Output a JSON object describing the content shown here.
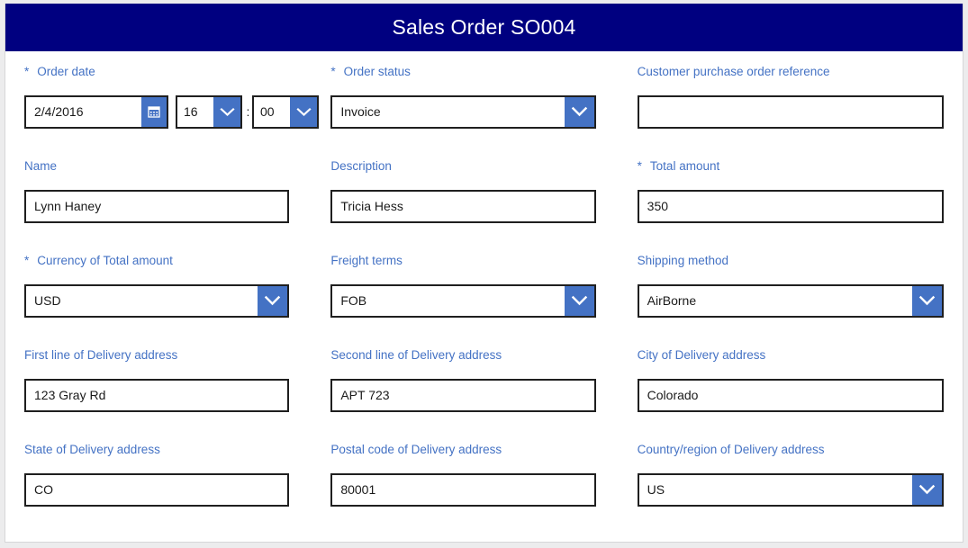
{
  "header": {
    "title": "Sales Order SO004",
    "background_color": "#000080",
    "text_color": "#ffffff"
  },
  "theme": {
    "label_color": "#4472c4",
    "accent_color": "#4472c4",
    "input_border_color": "#1f1f1f",
    "page_background": "#ececed",
    "card_background": "#ffffff"
  },
  "form": {
    "required_marker": "*",
    "time_separator": ":",
    "rows": [
      {
        "fields": [
          {
            "name": "order-date",
            "label": "Order date",
            "required": true,
            "type": "datetime",
            "date_value": "2/4/2016",
            "hour_value": "16",
            "minute_value": "00",
            "calendar_icon": "calendar-icon",
            "dropdown_icon": "chevron-down-icon"
          },
          {
            "name": "order-status",
            "label": "Order status",
            "required": true,
            "type": "combobox",
            "value": "Invoice",
            "dropdown_icon": "chevron-down-icon"
          },
          {
            "name": "customer-purchase-order-reference",
            "label": "Customer purchase order reference",
            "required": false,
            "type": "text",
            "value": "",
            "placeholder": ""
          }
        ]
      },
      {
        "fields": [
          {
            "name": "name",
            "label": "Name",
            "required": false,
            "type": "text",
            "value": "Lynn Haney",
            "placeholder": ""
          },
          {
            "name": "description",
            "label": "Description",
            "required": false,
            "type": "text",
            "value": "Tricia Hess",
            "placeholder": ""
          },
          {
            "name": "total-amount",
            "label": "Total amount",
            "required": true,
            "type": "text",
            "value": "350",
            "placeholder": ""
          }
        ]
      },
      {
        "fields": [
          {
            "name": "currency-of-total-amount",
            "label": "Currency of Total amount",
            "required": true,
            "type": "combobox",
            "value": "USD",
            "dropdown_icon": "chevron-down-icon"
          },
          {
            "name": "freight-terms",
            "label": "Freight terms",
            "required": false,
            "type": "combobox",
            "value": "FOB",
            "dropdown_icon": "chevron-down-icon"
          },
          {
            "name": "shipping-method",
            "label": "Shipping method",
            "required": false,
            "type": "combobox",
            "value": "AirBorne",
            "dropdown_icon": "chevron-down-icon"
          }
        ]
      },
      {
        "fields": [
          {
            "name": "first-line-of-delivery-address",
            "label": "First line of Delivery address",
            "required": false,
            "type": "text",
            "value": "123 Gray Rd",
            "placeholder": ""
          },
          {
            "name": "second-line-of-delivery-address",
            "label": "Second line of Delivery address",
            "required": false,
            "type": "text",
            "value": "APT 723",
            "placeholder": ""
          },
          {
            "name": "city-of-delivery-address",
            "label": "City of Delivery address",
            "required": false,
            "type": "text",
            "value": "Colorado",
            "placeholder": ""
          }
        ]
      },
      {
        "fields": [
          {
            "name": "state-of-delivery-address",
            "label": "State of Delivery address",
            "required": false,
            "type": "text",
            "value": "CO",
            "placeholder": ""
          },
          {
            "name": "postal-code-of-delivery-address",
            "label": "Postal code of Delivery address",
            "required": false,
            "type": "text",
            "value": "80001",
            "placeholder": ""
          },
          {
            "name": "country-region-of-delivery-address",
            "label": "Country/region of Delivery address",
            "required": false,
            "type": "combobox",
            "value": "US",
            "dropdown_icon": "chevron-down-icon"
          }
        ]
      }
    ]
  }
}
